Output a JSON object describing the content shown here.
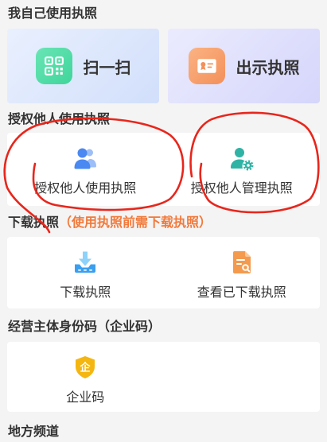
{
  "sections": {
    "self_use_title": "我自己使用执照",
    "authorize_title": "授权他人使用执照",
    "download_title": "下载执照",
    "download_note": "（使用执照前需下载执照）",
    "entity_code_title": "经营主体身份码（企业码）",
    "local_channel_title": "地方频道"
  },
  "self_use": [
    {
      "label": "扫一扫",
      "icon": "qr-code-icon"
    },
    {
      "label": "出示执照",
      "icon": "license-card-icon"
    }
  ],
  "authorize": [
    {
      "label": "授权他人使用执照",
      "icon": "users-icon"
    },
    {
      "label": "授权他人管理执照",
      "icon": "user-gear-icon"
    }
  ],
  "download": [
    {
      "label": "下载执照",
      "icon": "download-icon"
    },
    {
      "label": "查看已下载执照",
      "icon": "document-search-icon"
    }
  ],
  "entity_code": [
    {
      "label": "企业码",
      "icon": "enterprise-shield-icon",
      "icon_glyph": "企"
    }
  ],
  "colors": {
    "page_background": "#f4f4f4",
    "card_background": "#ffffff",
    "title_text": "#333333",
    "label_text": "#333333",
    "note_text": "#f2793a",
    "scan_icon": "#3fd59b",
    "license_icon": "#f3905a",
    "users_icon": "#4a88f2",
    "users_icon_light": "#9dbff8",
    "user_gear_icon": "#2fb3a5",
    "download_icon": "#3a9ff0",
    "download_icon_light": "#8dd2fa",
    "document_icon": "#f49a4e",
    "document_icon_light": "#fbc896",
    "shield_icon": "#f4b610",
    "annotation_red": "#e8261c"
  }
}
